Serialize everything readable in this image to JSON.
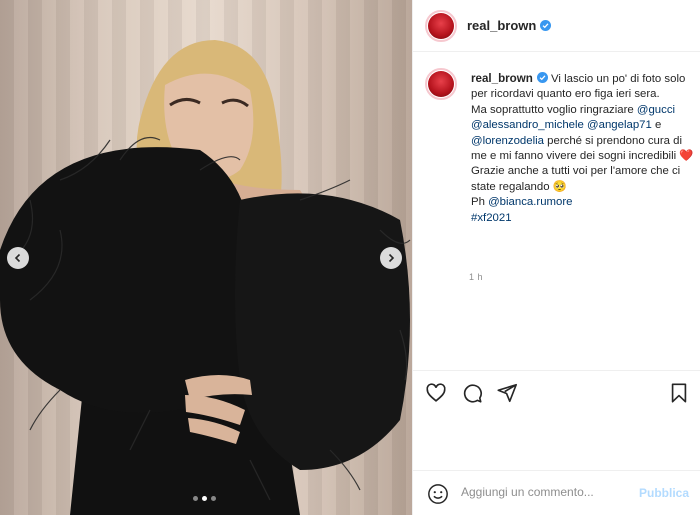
{
  "post": {
    "image": {
      "alt_icon": "photo-carousel",
      "slide_count": 3,
      "active_slide": 2
    },
    "header": {
      "username": "real_brown",
      "verified_icon": "verified-badge-icon"
    },
    "caption": {
      "username": "real_brown",
      "text1": " Vi lascio un po' di foto solo per ricordavi quanto ero figa ieri sera.",
      "text2": "Ma soprattutto voglio ringraziare ",
      "mention_gucci": "@gucci",
      "mention_alessandro": "@alessandro_michele",
      "mention_angela": "@angelap71",
      "text_e": " e ",
      "mention_lorenzo": "@lorenzodelia",
      "text3": " perché si prendono cura di me e mi fanno vivere dei sogni incredibili ",
      "heart": "❤️",
      "text4": "Grazie anche a tutti voi per l'amore che ci state regalando ",
      "blush": "🥺",
      "text_ph": "Ph ",
      "mention_bianca": "@bianca.rumore",
      "hashtag": "#xf2021"
    },
    "timestamp": "1 h"
  },
  "actions": {
    "like_icon": "heart-icon",
    "comment_icon": "comment-icon",
    "share_icon": "share-icon",
    "save_icon": "bookmark-icon"
  },
  "comment_box": {
    "placeholder": "Aggiungi un commento...",
    "publish_label": "Pubblica"
  },
  "colors": {
    "link": "#00376b",
    "publish_disabled": "#b3dbff",
    "verified": "#3897f0",
    "heart": "#ed4956"
  }
}
